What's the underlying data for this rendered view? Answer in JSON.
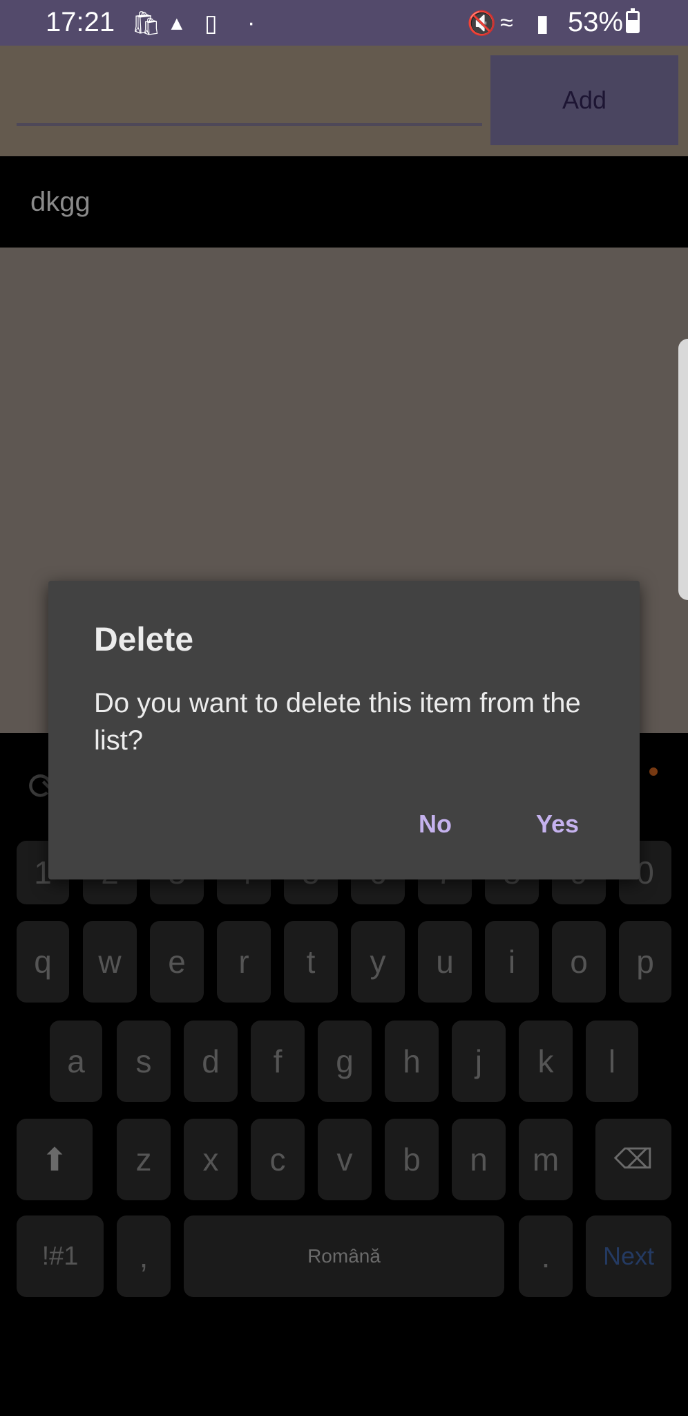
{
  "status_bar": {
    "time": "17:21",
    "battery_percent": "53%",
    "icons_left": [
      "shopping-bag-icon",
      "warning-mm-icon",
      "message-icon",
      "dot-icon"
    ],
    "icons_right": [
      "mute-icon",
      "wifi-icon",
      "signal-icon",
      "battery-charging-icon"
    ]
  },
  "app": {
    "add_label": "Add",
    "input_placeholder": "",
    "list_items": [
      "dkgg"
    ]
  },
  "dialog": {
    "title": "Delete",
    "message": "Do you want to delete this item from the list?",
    "no_label": "No",
    "yes_label": "Yes"
  },
  "keyboard": {
    "numbers": [
      "1",
      "2",
      "3",
      "4",
      "5",
      "6",
      "7",
      "8",
      "9",
      "0"
    ],
    "row1": [
      "q",
      "w",
      "e",
      "r",
      "t",
      "y",
      "u",
      "i",
      "o",
      "p"
    ],
    "row2": [
      "a",
      "s",
      "d",
      "f",
      "g",
      "h",
      "j",
      "k",
      "l"
    ],
    "row3": [
      "z",
      "x",
      "c",
      "v",
      "b",
      "n",
      "m"
    ],
    "symbols_label": "!#1",
    "comma_label": ",",
    "space_label": "Română",
    "period_label": ".",
    "next_label": "Next"
  },
  "colors": {
    "status_bar": "#534a6b",
    "dialog_bg": "#424242",
    "dialog_button": "#c5b2ee",
    "next_key": "#243a62"
  }
}
